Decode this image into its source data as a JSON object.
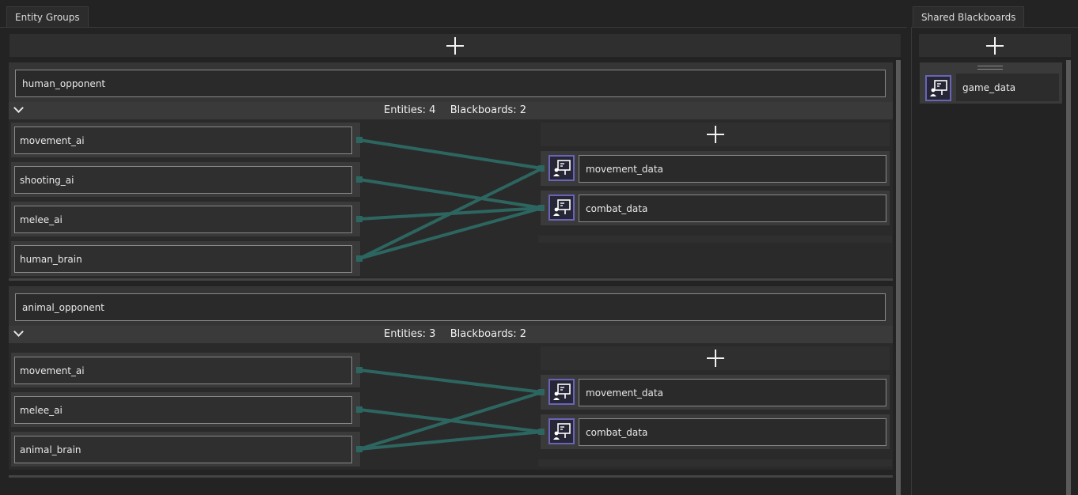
{
  "left_tab": {
    "label": "Entity Groups"
  },
  "right_tab": {
    "label": "Shared Blackboards"
  },
  "groups": [
    {
      "name": "human_opponent",
      "stats": {
        "entities_label": "Entities:",
        "entities": "4",
        "blackboards_label": "Blackboards:",
        "blackboards": "2"
      },
      "entities": [
        {
          "name": "movement_ai"
        },
        {
          "name": "shooting_ai"
        },
        {
          "name": "melee_ai"
        },
        {
          "name": "human_brain"
        }
      ],
      "blackboards": [
        {
          "name": "movement_data"
        },
        {
          "name": "combat_data"
        }
      ],
      "links": [
        [
          0,
          0
        ],
        [
          1,
          1
        ],
        [
          2,
          1
        ],
        [
          3,
          0
        ],
        [
          3,
          1
        ]
      ]
    },
    {
      "name": "animal_opponent",
      "stats": {
        "entities_label": "Entities:",
        "entities": "3",
        "blackboards_label": "Blackboards:",
        "blackboards": "2"
      },
      "entities": [
        {
          "name": "movement_ai"
        },
        {
          "name": "melee_ai"
        },
        {
          "name": "animal_brain"
        }
      ],
      "blackboards": [
        {
          "name": "movement_data"
        },
        {
          "name": "combat_data"
        }
      ],
      "links": [
        [
          0,
          0
        ],
        [
          1,
          1
        ],
        [
          2,
          0
        ],
        [
          2,
          1
        ]
      ]
    }
  ],
  "shared_blackboards": [
    {
      "name": "game_data"
    }
  ],
  "icons": {
    "add": "plus-icon",
    "collapse": "chevron-down-icon",
    "blackboard": "blackboard-icon",
    "drag": "drag-handle-icon"
  },
  "colors": {
    "link": "#2d6660",
    "icon_border": "#6a64b8"
  }
}
